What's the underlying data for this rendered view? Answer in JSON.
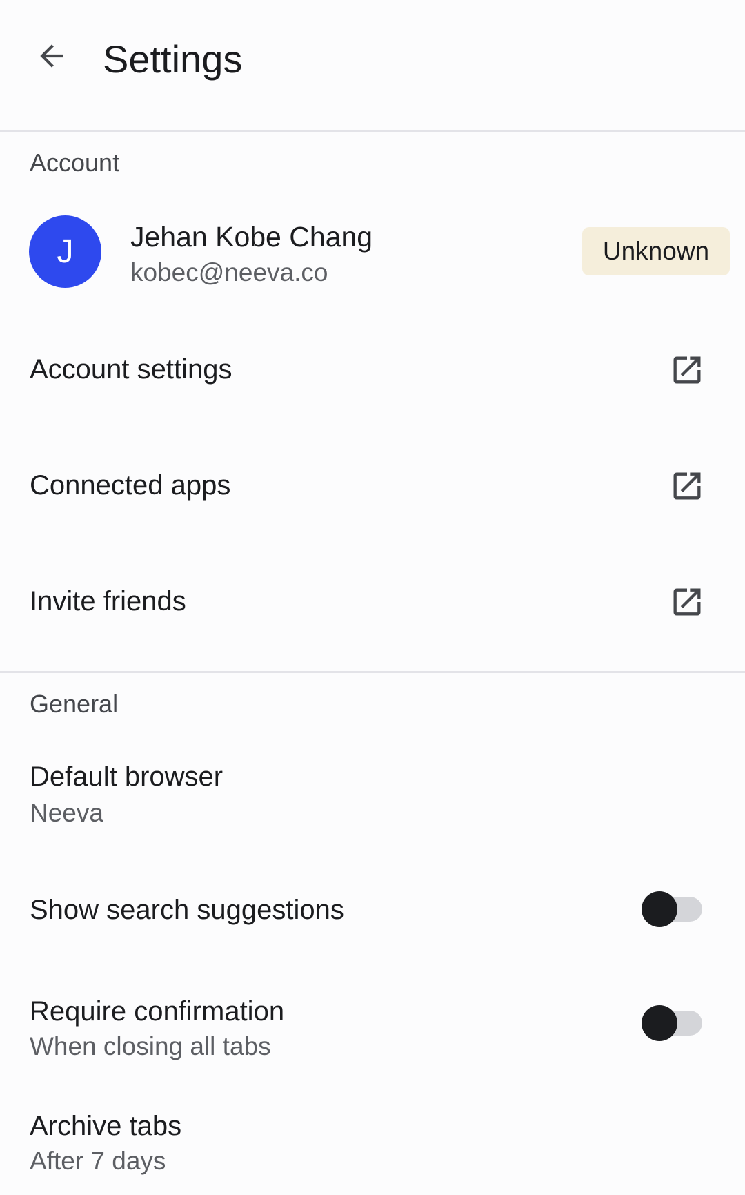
{
  "header": {
    "title": "Settings",
    "back_icon": "arrow-back-icon"
  },
  "account_section": {
    "label": "Account",
    "user": {
      "avatar_initial": "J",
      "avatar_color": "#2e49ee",
      "name": "Jehan Kobe Chang",
      "email": "kobec@neeva.co",
      "status_badge": "Unknown",
      "badge_color": "#f5eedb"
    },
    "items": [
      {
        "label": "Account settings",
        "icon": "open-in-new-icon"
      },
      {
        "label": "Connected apps",
        "icon": "open-in-new-icon"
      },
      {
        "label": "Invite friends",
        "icon": "open-in-new-icon"
      }
    ]
  },
  "general_section": {
    "label": "General",
    "default_browser": {
      "label": "Default browser",
      "value": "Neeva"
    },
    "search_suggestions": {
      "label": "Show search suggestions",
      "enabled": false
    },
    "require_confirmation": {
      "label": "Require confirmation",
      "subtitle": "When closing all tabs",
      "enabled": false
    },
    "archive_tabs": {
      "label": "Archive tabs",
      "value": "After 7 days"
    }
  }
}
